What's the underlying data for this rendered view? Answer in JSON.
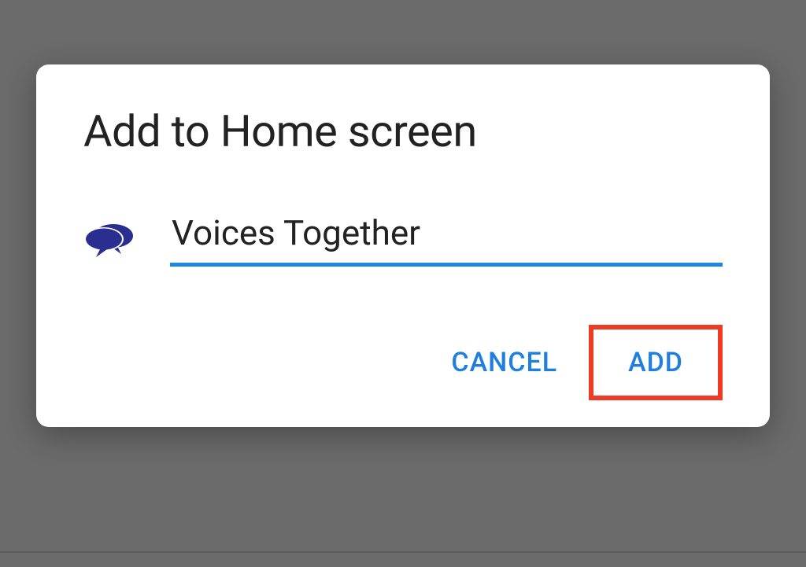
{
  "dialog": {
    "title": "Add to Home screen",
    "input_value": "Voices Together",
    "cancel_label": "CANCEL",
    "add_label": "ADD",
    "accent_color": "#1e87e5",
    "highlight_color": "#ef3a26",
    "icon_name": "speech-bubbles-icon",
    "icon_color": "#2a2e91"
  }
}
